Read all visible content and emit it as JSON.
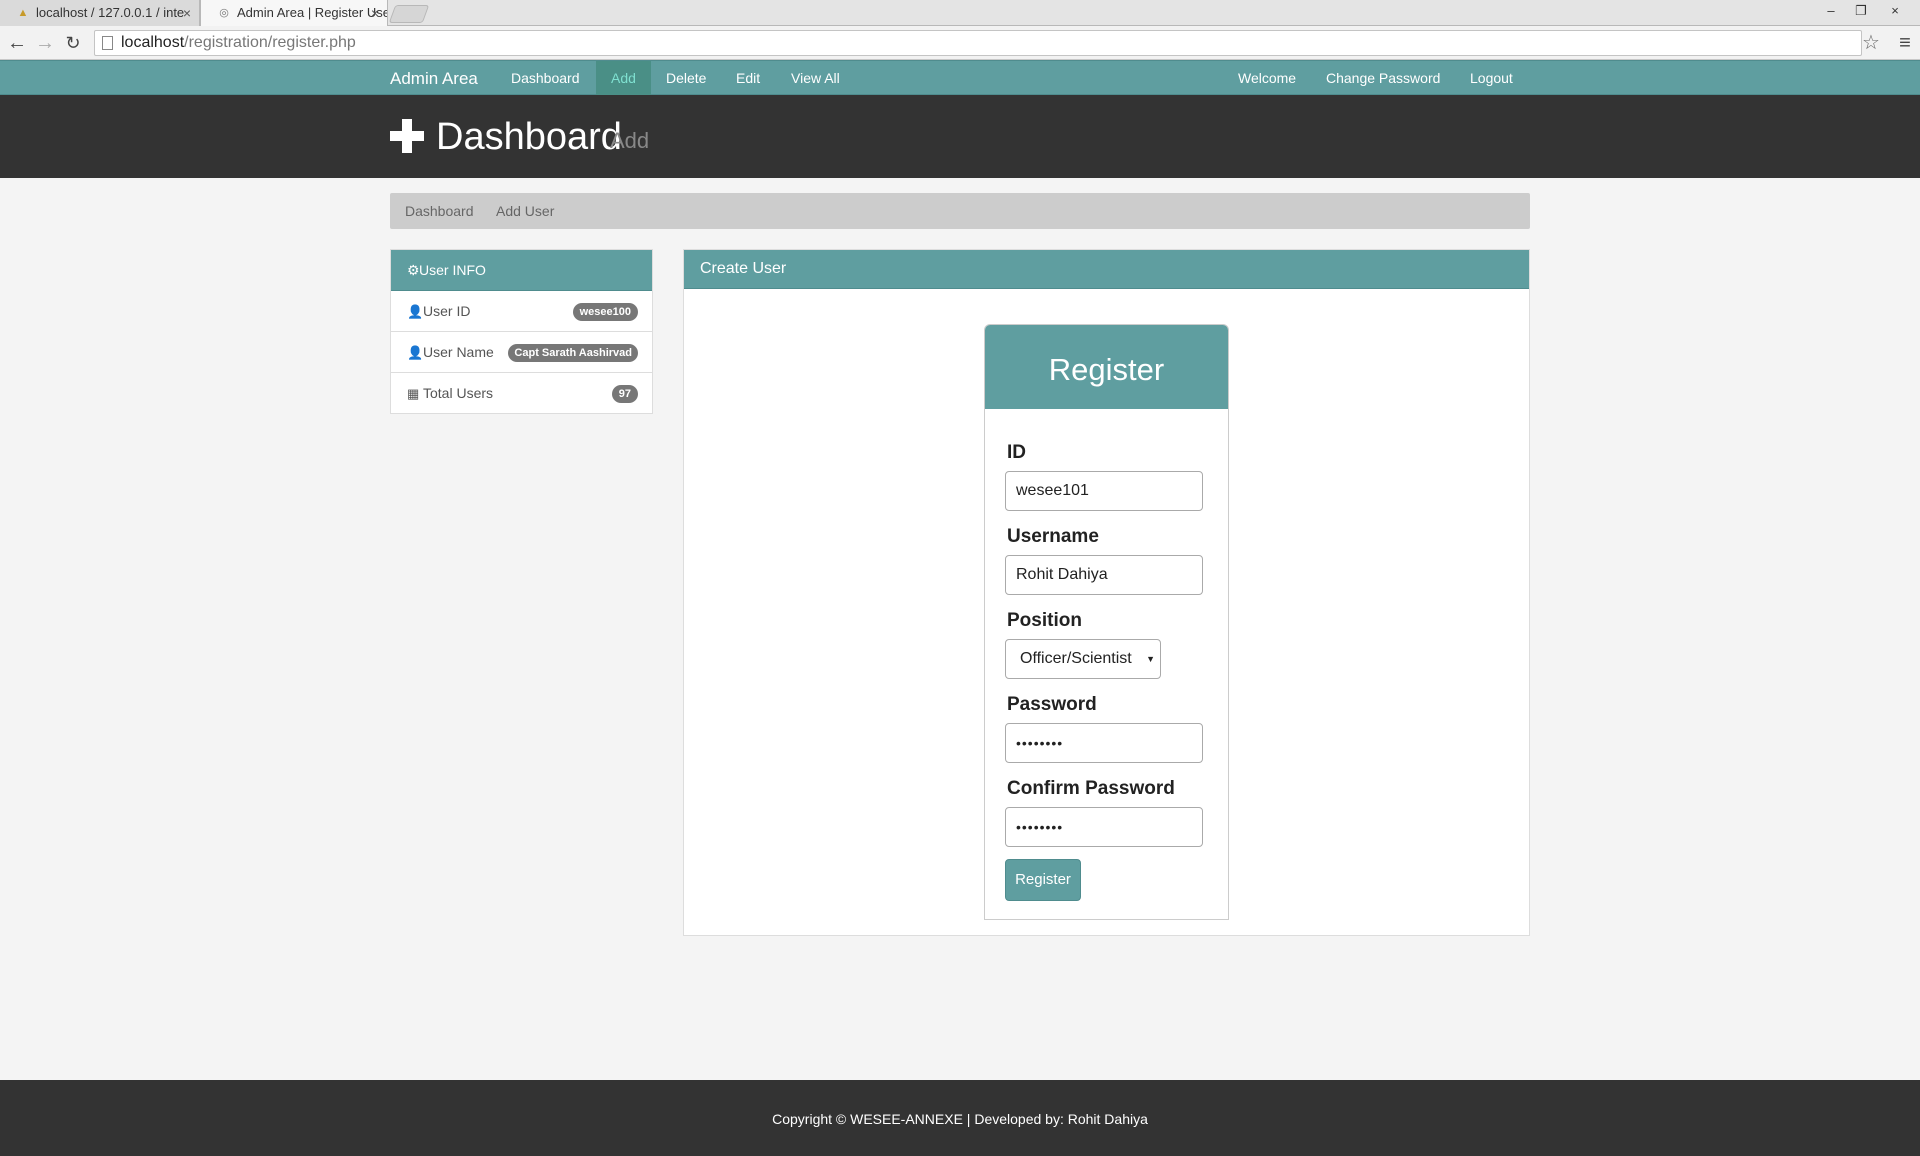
{
  "browser": {
    "tabs": [
      {
        "title": "localhost / 127.0.0.1 / inte",
        "close": "×"
      },
      {
        "title": "Admin Area | Register Use",
        "close": "×"
      }
    ],
    "url_host": "localhost",
    "url_path": "/registration/register.php",
    "window_controls": [
      "–",
      "❐",
      "×"
    ]
  },
  "navbar": {
    "brand": "Admin Area",
    "links": [
      "Dashboard",
      "Add",
      "Delete",
      "Edit",
      "View All"
    ],
    "active_link": "Add",
    "right_links": [
      "Welcome",
      "Change Password",
      "Logout"
    ]
  },
  "header": {
    "title": "Dashboard",
    "subtitle": "Add"
  },
  "breadcrumb": [
    "Dashboard",
    "Add User"
  ],
  "sidebar": {
    "title": "User INFO",
    "rows": [
      {
        "label": "User ID",
        "value": "wesee100",
        "icon": "user-icon"
      },
      {
        "label": "User Name",
        "value": "Capt Sarath Aashirvad",
        "icon": "user-icon"
      },
      {
        "label": "Total Users",
        "value": "97",
        "icon": "grid-icon"
      }
    ]
  },
  "main": {
    "title": "Create User",
    "form": {
      "title": "Register",
      "id_label": "ID",
      "id_value": "wesee101",
      "username_label": "Username",
      "username_value": "Rohit Dahiya",
      "position_label": "Position",
      "position_value": "Officer/Scientist",
      "password_label": "Password",
      "password_value": "••••••••",
      "confirm_label": "Confirm Password",
      "confirm_value": "••••••••",
      "submit_label": "Register"
    }
  },
  "footer": {
    "text": "Copyright © WESEE-ANNEXE | Developed by: Rohit Dahiya"
  },
  "colors": {
    "accent": "#5f9ea0",
    "header_bg": "#333333",
    "page_bg": "#f4f4f4"
  }
}
